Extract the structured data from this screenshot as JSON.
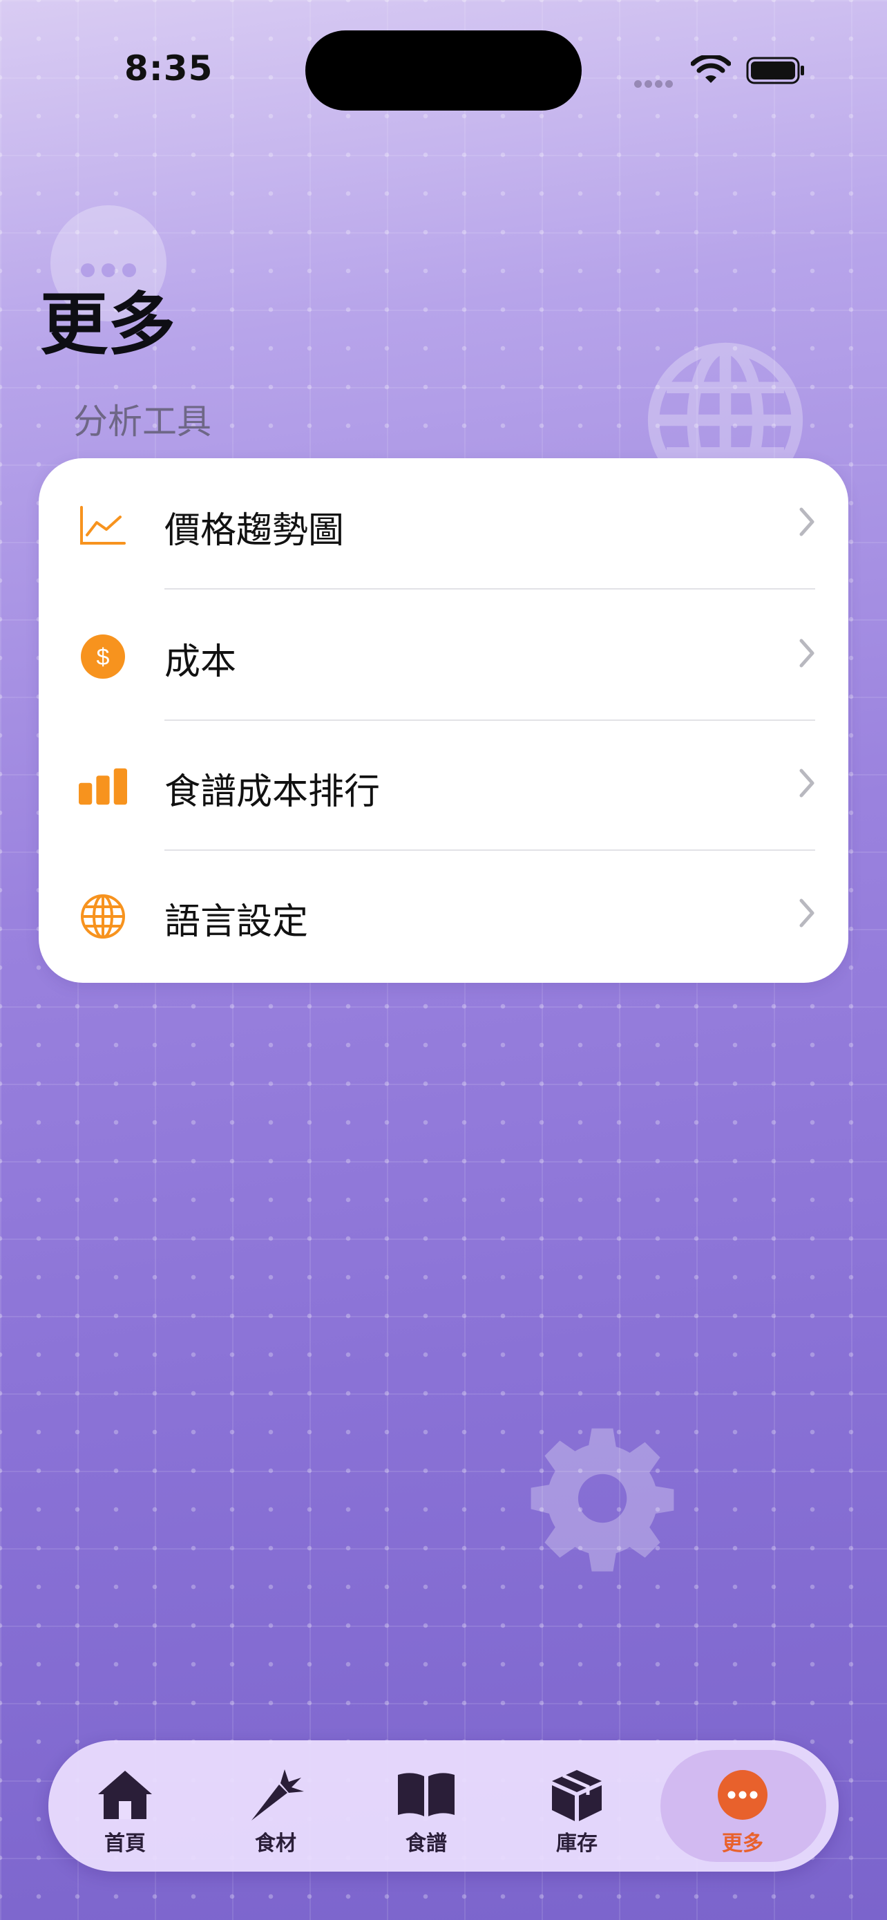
{
  "status_bar": {
    "time": "8:35"
  },
  "header": {
    "title": "更多",
    "section_label": "分析工具"
  },
  "menu": {
    "items": [
      {
        "label": "價格趨勢圖",
        "icon": "line-chart-icon"
      },
      {
        "label": "成本",
        "icon": "dollar-circle-icon"
      },
      {
        "label": "食譜成本排行",
        "icon": "bar-chart-icon"
      },
      {
        "label": "語言設定",
        "icon": "globe-icon"
      }
    ]
  },
  "tab_bar": {
    "tabs": [
      {
        "label": "首頁",
        "icon": "house-icon"
      },
      {
        "label": "食材",
        "icon": "carrot-icon"
      },
      {
        "label": "食譜",
        "icon": "book-icon"
      },
      {
        "label": "庫存",
        "icon": "box-icon"
      },
      {
        "label": "更多",
        "icon": "ellipsis-circle-icon"
      }
    ],
    "active_index": 4
  },
  "colors": {
    "accent": "#F7931E",
    "active_tab": "#E8612C",
    "background": "#9A82DE"
  }
}
